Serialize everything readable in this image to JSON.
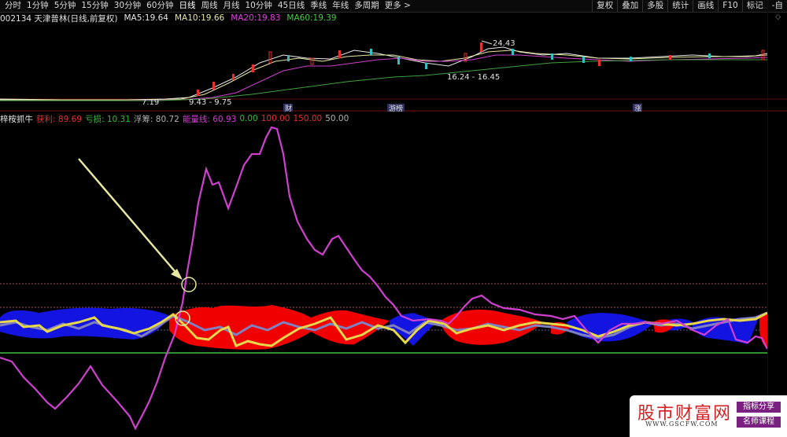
{
  "toolbar": {
    "timeframes": [
      "分时",
      "1分钟",
      "5分钟",
      "15分钟",
      "30分钟",
      "60分钟",
      "日线",
      "周线",
      "月线",
      "10分钟",
      "45日线",
      "季线",
      "年线",
      "多周期",
      "更多 >"
    ],
    "tools": [
      "复权",
      "叠加",
      "多股",
      "统计",
      "画线",
      "F10",
      "标记",
      "-自"
    ]
  },
  "stock": {
    "title": "002134 天津普林(日线,前复权)",
    "ma": [
      {
        "label": "MA5: ",
        "value": "19.64"
      },
      {
        "label": "MA10: ",
        "value": "19.66"
      },
      {
        "label": "MA20: ",
        "value": "19.83"
      },
      {
        "label": "MA60: ",
        "value": "19.39"
      }
    ],
    "price_labels": [
      "24.43",
      "16.24 - 16.45",
      "9.43 - 9.75",
      "7.19"
    ],
    "markers": [
      "财",
      "游榜",
      "涨"
    ]
  },
  "indicator": {
    "name": "梓桉抓牛",
    "items": [
      {
        "label": "获利: ",
        "value": "89.69"
      },
      {
        "label": "亏损: ",
        "value": "10.31"
      },
      {
        "label": "浮筹: ",
        "value": "80.72"
      },
      {
        "label": "能量线: ",
        "value": "60.93"
      },
      {
        "label": "",
        "value": "0.00"
      },
      {
        "label": "",
        "value": "100.00"
      },
      {
        "label": "",
        "value": "150.00"
      },
      {
        "label": "",
        "value": "50.00"
      }
    ]
  },
  "watermark": {
    "title": "股市财富网",
    "url": "WWW.GSCFW.COM",
    "tag1": "指标分享",
    "tag2": "名师课程"
  },
  "colors": {
    "bg": "#000000",
    "magenta": "#d040d0",
    "yellow": "#e6d84a",
    "blue": "#1414e0",
    "red": "#f00000",
    "green": "#40c040",
    "slate": "#8080c0"
  }
}
